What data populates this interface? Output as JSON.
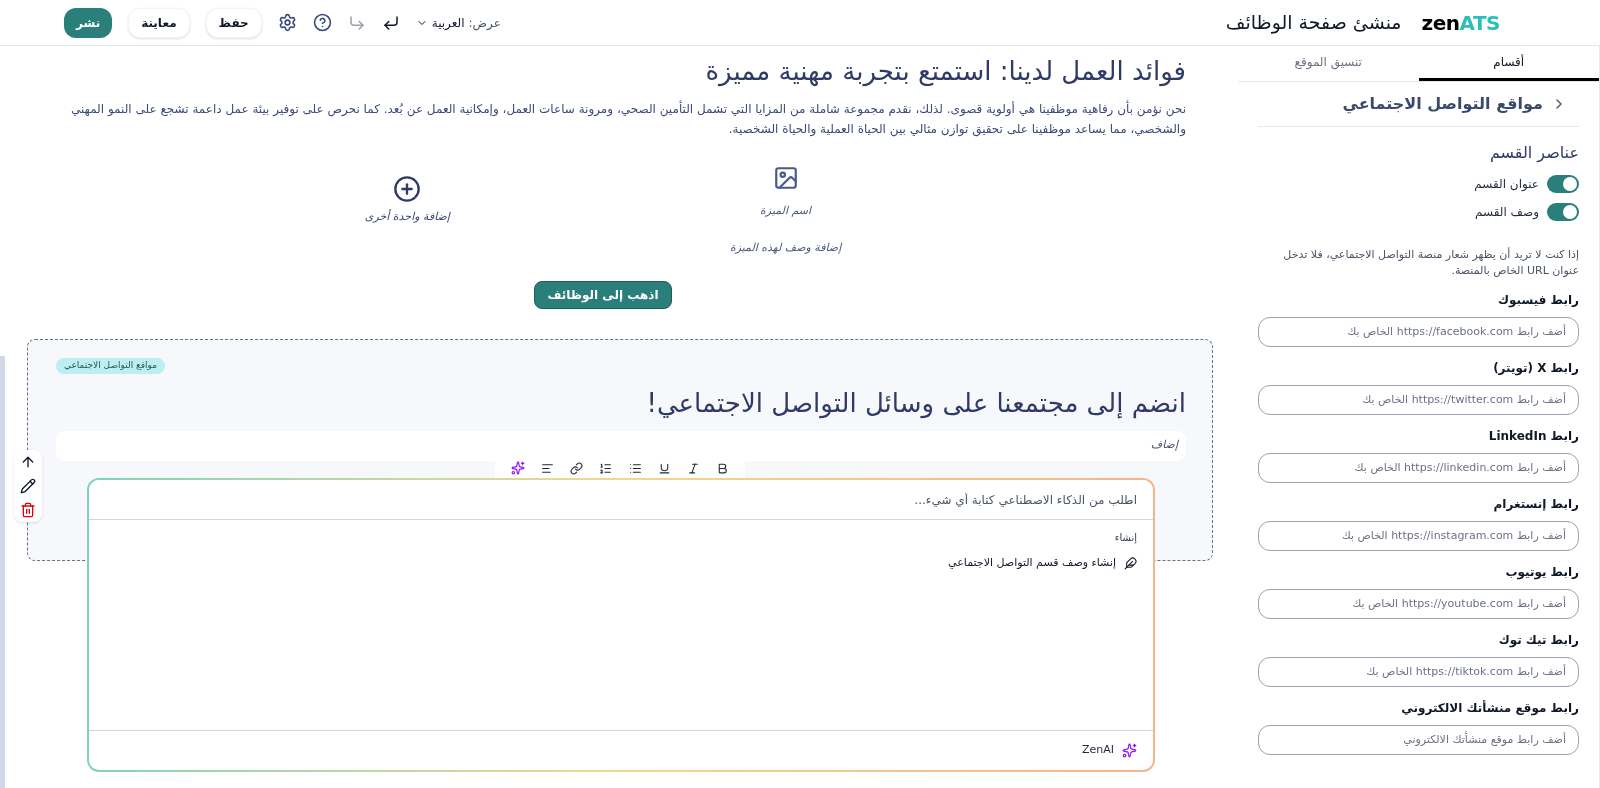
{
  "header": {
    "logo": {
      "word": "zen",
      "accent": "ATS"
    },
    "title": "منشئ صفحة الوظائف",
    "view_label": "عرض:",
    "language": "العربية",
    "redo": {
      "disabled": false
    },
    "undo": {
      "disabled": true
    },
    "buttons": [
      {
        "label": "حفظ",
        "kind": "outline"
      },
      {
        "label": "معاينة",
        "kind": "outline"
      },
      {
        "label": "نشر",
        "kind": "primary"
      }
    ]
  },
  "canvas": {
    "benefits": {
      "heading": "فوائد العمل لدينا: استمتع بتجربة مهنية مميزة",
      "paragraph": "نحن نؤمن بأن رفاهية موظفينا هي أولوية قصوى. لذلك، نقدم مجموعة شاملة من المزايا التي تشمل التأمين الصحي، ومرونة ساعات العمل، وإمكانية العمل عن بُعد. كما نحرص على توفير بيئة عمل داعمة تشجع على النمو المهني والشخصي، مما يساعد موظفينا على تحقيق توازن مثالي بين الحياة العملية والحياة الشخصية.",
      "features": [
        {
          "kind": "feature",
          "title": "اسم الميزة",
          "description": "إضافة وصف لهذه الميزة"
        },
        {
          "kind": "add",
          "label": "إضافة واحدة أخرى"
        }
      ],
      "cta": "اذهب إلى الوظائف"
    },
    "social": {
      "tag": "مواقع التواصل الاجتماعي",
      "heading": "انضم إلى مجتمعنا على وسائل التواصل الاجتماعي!",
      "description": "إضاف"
    },
    "ai_panel": {
      "placeholder": "اطلب من الذكاء الاصطناعي كتابة أي شيء...",
      "group": "إنشاء",
      "suggestions": [
        "إنشاء وصف قسم التواصل الاجتماعي"
      ],
      "brand": "ZenAI"
    }
  },
  "sidebar": {
    "tabs": [
      {
        "label": "أقسام",
        "selected": true
      },
      {
        "label": "تنسيق الموقع",
        "selected": false
      }
    ],
    "title": "مواقع التواصل الاجتماعي",
    "elements_heading": "عناصر القسم",
    "toggles": [
      {
        "label": "عنوان القسم",
        "on": true
      },
      {
        "label": "وصف القسم",
        "on": true
      }
    ],
    "note": "إذا كنت لا تريد أن يظهر شعار منصة التواصل الاجتماعي، فلا تدخل عنوان URL الخاص بالمنصة.",
    "links": [
      {
        "label": "رابط فيسبوك",
        "placeholder": "أضف رابط https://facebook.com الخاص بك"
      },
      {
        "label": "رابط X (تويتر)",
        "placeholder": "أضف رابط https://twitter.com الخاص بك"
      },
      {
        "label": "رابط LinkedIn",
        "placeholder": "أضف رابط https://linkedin.com الخاص بك"
      },
      {
        "label": "رابط إنستغرام",
        "placeholder": "أضف رابط https://instagram.com الخاص بك"
      },
      {
        "label": "رابط يوتيوب",
        "placeholder": "أضف رابط https://youtube.com الخاص بك"
      },
      {
        "label": "رابط تيك توك",
        "placeholder": "أضف رابط https://tiktok.com الخاص بك"
      },
      {
        "label": "رابط موقع منشأتك الالكتروني",
        "placeholder": "أضف رابط موقع منشأتك الالكتروني"
      }
    ]
  }
}
